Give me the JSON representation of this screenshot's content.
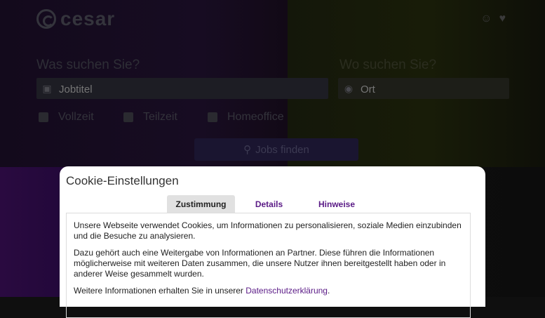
{
  "header": {
    "logo_text": "cesar",
    "icons": [
      "user-icon",
      "heart-icon"
    ]
  },
  "search": {
    "what_label": "Was suchen Sie?",
    "what_placeholder": "Jobtitel",
    "where_label": "Wo suchen Sie?",
    "where_placeholder": "Ort",
    "options": [
      "Vollzeit",
      "Teilzeit",
      "Homeoffice"
    ],
    "button_label": "Jobs finden"
  },
  "cookie": {
    "title": "Cookie-Einstellungen",
    "tabs": [
      "Zustimmung",
      "Details",
      "Hinweise"
    ],
    "active_tab": "Zustimmung",
    "paragraph1": "Unsere Webseite verwendet Cookies, um Informationen zu personalisieren, soziale Medien einzubinden und die Besuche zu analysieren.",
    "paragraph2": "Dazu gehört auch eine Weitergabe von Informationen an Partner. Diese führen die Informationen möglicherweise mit weiteren Daten zusammen, die unsere Nutzer ihnen bereitgestellt haben oder in anderer Weise gesammelt wurden.",
    "paragraph3_prefix": "Weitere Informationen erhalten Sie in unserer ",
    "privacy_link": "Datenschutzerklärung",
    "paragraph3_suffix": "."
  },
  "colors": {
    "accent": "#5a1a86",
    "modal_bg": "#ffffff",
    "active_tab_bg": "#e1e1e1"
  }
}
